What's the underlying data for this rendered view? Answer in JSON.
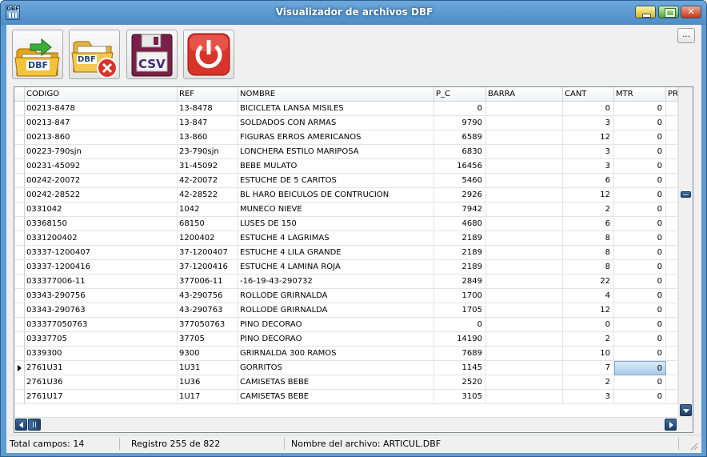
{
  "window": {
    "title": "Visualizador de archivos DBF"
  },
  "toolbar": {
    "open_dbf_label": "DBF",
    "close_dbf_label": "DBF",
    "export_csv_label": "CSV",
    "more_label": "..."
  },
  "table": {
    "columns": [
      "CODIGO",
      "REF",
      "NOMBRE",
      "P_C",
      "BARRA",
      "CANT",
      "MTR",
      "PR"
    ],
    "rows": [
      [
        "00213-8478",
        "13-8478",
        "BICICLETA LANSA MISILES",
        "0",
        "",
        "0",
        "0"
      ],
      [
        "00213-847",
        "13-847",
        "SOLDADOS CON ARMAS",
        "9790",
        "",
        "3",
        "0"
      ],
      [
        "00213-860",
        "13-860",
        "FIGURAS ERROS AMERICANOS",
        "6589",
        "",
        "12",
        "0"
      ],
      [
        "00223-790sjn",
        "23-790sjn",
        "LONCHERA ESTILO MARIPOSA",
        "6830",
        "",
        "3",
        "0"
      ],
      [
        "00231-45092",
        "31-45092",
        "BEBE MULATO",
        "16456",
        "",
        "3",
        "0"
      ],
      [
        "00242-20072",
        "42-20072",
        "ESTUCHE DE 5 CARITOS",
        "5460",
        "",
        "6",
        "0"
      ],
      [
        "00242-28522",
        "42-28522",
        "BL  HARO  BEICULOS DE CONTRUCION",
        "2926",
        "",
        "12",
        "0"
      ],
      [
        "0331042",
        "1042",
        "MUNECO NIEVE",
        "7942",
        "",
        "2",
        "0"
      ],
      [
        "03368150",
        "68150",
        "LUSES DE 150",
        "4680",
        "",
        "6",
        "0"
      ],
      [
        "0331200402",
        "1200402",
        "ESTUCHE 4  LAGRIMAS",
        "2189",
        "",
        "8",
        "0"
      ],
      [
        "03337-1200407",
        "37-1200407",
        "ESTUCHE 4  LILA GRANDE",
        "2189",
        "",
        "8",
        "0"
      ],
      [
        "03337-1200416",
        "37-1200416",
        "ESTUCHE 4  LAMINA ROJA",
        "2189",
        "",
        "8",
        "0"
      ],
      [
        "033377006-11",
        "377006-11",
        "-16-19-43-290732",
        "2849",
        "",
        "22",
        "0"
      ],
      [
        "03343-290756",
        "43-290756",
        "ROLLODE GRIRNALDA",
        "1700",
        "",
        "4",
        "0"
      ],
      [
        "03343-290763",
        "43-290763",
        "ROLLODE GRIRNALDA",
        "1705",
        "",
        "12",
        "0"
      ],
      [
        "033377050763",
        "377050763",
        "PINO DECORAO",
        "0",
        "",
        "0",
        "0"
      ],
      [
        "03337705",
        "37705",
        "PINO DECORAO",
        "14190",
        "",
        "2",
        "0"
      ],
      [
        "0339300",
        "9300",
        "GRIRNALDA  300 RAMOS",
        "7689",
        "",
        "10",
        "0"
      ],
      [
        "2761U31",
        "1U31",
        "GORRITOS",
        "1145",
        "",
        "7",
        "0"
      ],
      [
        "2761U36",
        "1U36",
        "CAMISETAS BEBE",
        "2520",
        "",
        "2",
        "0"
      ],
      [
        "2761U17",
        "1U17",
        "CAMISETAS BEBE",
        "3105",
        "",
        "3",
        "0"
      ]
    ],
    "current_row": 18,
    "current_col": 6
  },
  "status": {
    "fields": "Total campos: 14",
    "record": "Registro 255 de 822",
    "file": "Nombre del archivo: ARTICUL.DBF"
  }
}
